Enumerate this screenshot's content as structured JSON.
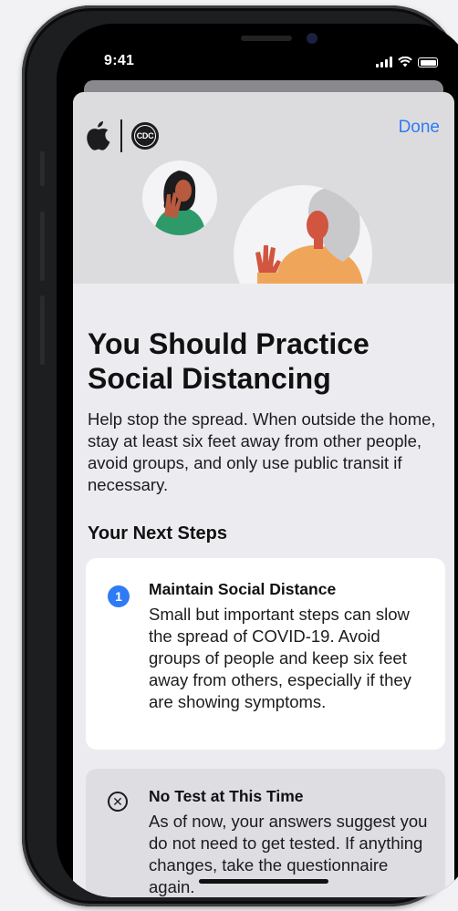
{
  "status": {
    "time": "9:41"
  },
  "header": {
    "done_label": "Done",
    "cdc_label": "CDC"
  },
  "main": {
    "title": "You Should Practice Social Distancing",
    "body": "Help stop the spread. When outside the home, stay at least six feet away from other people, avoid groups, and only use public transit if necessary.",
    "next_steps_heading": "Your Next Steps",
    "steps": [
      {
        "badge": "1",
        "title": "Maintain Social Distance",
        "text": "Small but important steps can slow the spread of COVID-19. Avoid groups of people and keep six feet away from others, especially if they are showing symptoms."
      },
      {
        "icon": "x-circle-icon",
        "title": "No Test at This Time",
        "text": "As of now, your answers suggest you do not need to get tested. If anything changes, take the questionnaire again."
      }
    ]
  },
  "colors": {
    "accent": "#2f7bf5",
    "hero_bg": "#dcdcdf",
    "sheet_bg": "#ececf0"
  }
}
